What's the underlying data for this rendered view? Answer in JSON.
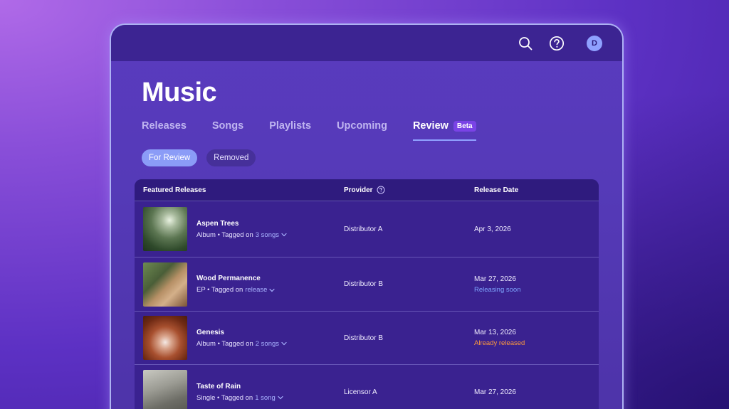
{
  "app": {
    "title": "Music"
  },
  "topbar": {
    "icons": [
      "search-icon",
      "help-icon"
    ],
    "avatar_initial": "D"
  },
  "tabs": [
    {
      "label": "Releases",
      "active": false
    },
    {
      "label": "Songs",
      "active": false
    },
    {
      "label": "Playlists",
      "active": false
    },
    {
      "label": "Upcoming",
      "active": false
    },
    {
      "label": "Review",
      "active": true,
      "badge": "Beta"
    }
  ],
  "filters": [
    {
      "label": "For Review",
      "active": true
    },
    {
      "label": "Removed",
      "active": false
    }
  ],
  "table": {
    "columns": [
      "Featured Releases",
      "Provider",
      "Release Date"
    ],
    "rows": [
      {
        "name": "Aspen Trees",
        "sub_prefix": "Album • Tagged on",
        "sub_link": "3 songs",
        "provider": "Distributor A",
        "date": "Apr 3, 2026",
        "status": ""
      },
      {
        "name": "Wood Permanence",
        "sub_prefix": "EP • Tagged on",
        "sub_link": "release",
        "provider": "Distributor B",
        "date": "Mar 27, 2026",
        "status": "Releasing soon"
      },
      {
        "name": "Genesis",
        "sub_prefix": "Album • Tagged on",
        "sub_link": "2 songs",
        "provider": "Distributor B",
        "date": "Mar 13, 2026",
        "status": "Already released"
      },
      {
        "name": "Taste of Rain",
        "sub_prefix": "Single • Tagged on",
        "sub_link": "1 song",
        "provider": "Licensor A",
        "date": "Mar 27, 2026",
        "status": ""
      }
    ]
  },
  "colors": {
    "accent": "#8fa1ff",
    "beta": "#7a43e6",
    "releasing_soon": "#7fa6ff",
    "already_released": "#ff9a3c"
  }
}
